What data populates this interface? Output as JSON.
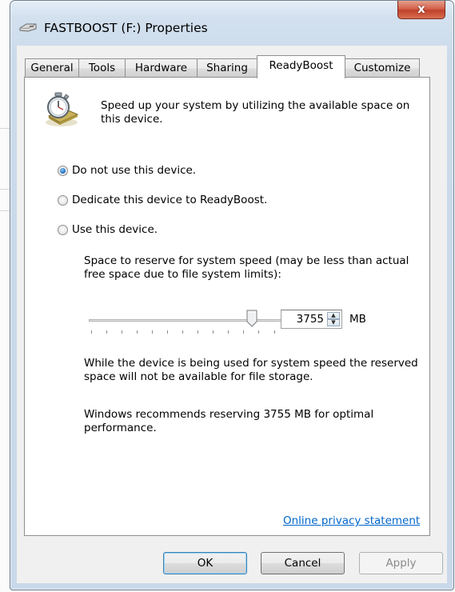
{
  "window": {
    "title": "FASTBOOST (F:) Properties",
    "close_symbol": "x"
  },
  "tabs": [
    {
      "label": "General"
    },
    {
      "label": "Tools"
    },
    {
      "label": "Hardware"
    },
    {
      "label": "Sharing"
    },
    {
      "label": "ReadyBoost",
      "active": true
    },
    {
      "label": "Customize"
    }
  ],
  "readyboost": {
    "icon": "readyboost-stopwatch-icon",
    "intro": "Speed up your system by utilizing the available space on this device.",
    "options": [
      {
        "label": "Do not use this device.",
        "checked": true
      },
      {
        "label": "Dedicate this device to ReadyBoost.",
        "checked": false
      },
      {
        "label": "Use this device.",
        "checked": false
      }
    ],
    "space_label": "Space to reserve for system speed (may be less than actual free space due to file system limits):",
    "reserve_value": "3755",
    "unit": "MB",
    "slider_level": 0.85,
    "storage_note": "While the device is being used for system speed the reserved space will not be available for file storage.",
    "recommendation": "Windows recommends reserving 3755 MB for optimal performance.",
    "privacy_link": "Online privacy statement"
  },
  "buttons": {
    "ok": "OK",
    "cancel": "Cancel",
    "apply": "Apply"
  },
  "colors": {
    "link": "#0066cc",
    "close_button": "#c7432e",
    "radio_selected": "#2b79c9"
  }
}
